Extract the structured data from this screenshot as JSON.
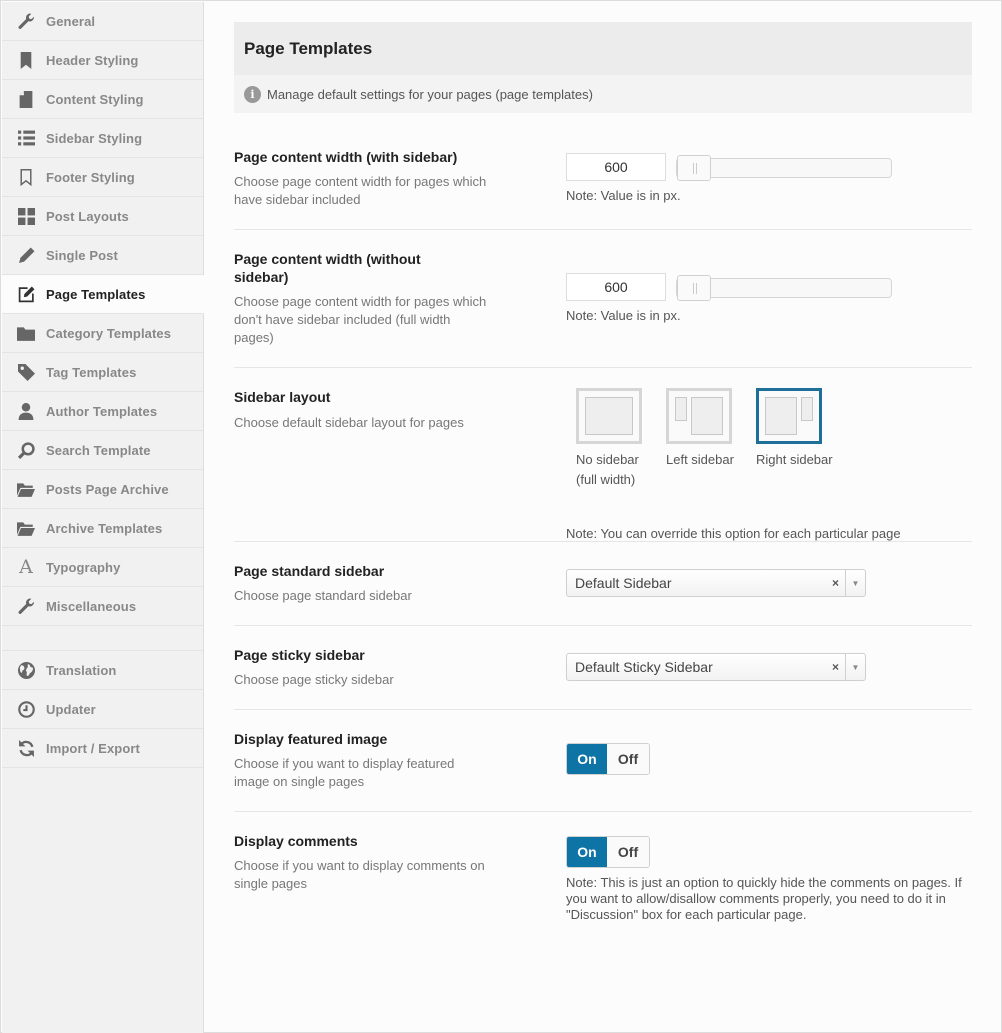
{
  "sidebar": {
    "items": [
      {
        "label": "General",
        "icon": "wrench-icon"
      },
      {
        "label": "Header Styling",
        "icon": "bookmark-icon"
      },
      {
        "label": "Content Styling",
        "icon": "document-icon"
      },
      {
        "label": "Sidebar Styling",
        "icon": "list-icon"
      },
      {
        "label": "Footer Styling",
        "icon": "bookmark-outline-icon"
      },
      {
        "label": "Post Layouts",
        "icon": "grid-icon"
      },
      {
        "label": "Single Post",
        "icon": "pencil-icon"
      },
      {
        "label": "Page Templates",
        "icon": "edit-icon"
      },
      {
        "label": "Category Templates",
        "icon": "folder-icon"
      },
      {
        "label": "Tag Templates",
        "icon": "tag-icon"
      },
      {
        "label": "Author Templates",
        "icon": "user-icon"
      },
      {
        "label": "Search Template",
        "icon": "search-icon"
      },
      {
        "label": "Posts Page Archive",
        "icon": "folder-open-icon"
      },
      {
        "label": "Archive Templates",
        "icon": "folder-open-icon"
      },
      {
        "label": "Typography",
        "icon": "font-icon"
      },
      {
        "label": "Miscellaneous",
        "icon": "wrench-icon"
      }
    ],
    "extra_items": [
      {
        "label": "Translation",
        "icon": "globe-icon"
      },
      {
        "label": "Updater",
        "icon": "clock-icon"
      },
      {
        "label": "Import / Export",
        "icon": "refresh-icon"
      }
    ],
    "active": "Page Templates"
  },
  "panel": {
    "title": "Page Templates",
    "info": "Manage default settings for your pages (page templates)"
  },
  "settings": {
    "width_sidebar": {
      "title": "Page content width (with sidebar)",
      "desc": "Choose page content width for pages which have sidebar included",
      "value": "600",
      "note": "Note: Value is in px."
    },
    "width_nosidebar": {
      "title": "Page content width (without sidebar)",
      "desc": "Choose page content width for pages which don't have sidebar included (full width pages)",
      "value": "600",
      "note": "Note: Value is in px."
    },
    "sidebar_layout": {
      "title": "Sidebar layout",
      "desc": "Choose default sidebar layout for pages",
      "options": [
        "No sidebar (full width)",
        "Left sidebar",
        "Right sidebar"
      ],
      "selected": "Right sidebar",
      "note": "Note: You can override this option for each particular page"
    },
    "standard_sidebar": {
      "title": "Page standard sidebar",
      "desc": "Choose page standard sidebar",
      "value": "Default Sidebar",
      "clear": "×"
    },
    "sticky_sidebar": {
      "title": "Page sticky sidebar",
      "desc": "Choose page sticky sidebar",
      "value": "Default Sticky Sidebar",
      "clear": "×"
    },
    "featured_image": {
      "title": "Display featured image",
      "desc": "Choose if you want to display featured image on single pages",
      "on": "On",
      "off": "Off",
      "state": "On"
    },
    "comments": {
      "title": "Display comments",
      "desc": "Choose if you want to display comments on single pages",
      "on": "On",
      "off": "Off",
      "state": "On",
      "note": "Note: This is just an option to quickly hide the comments on pages. If you want to allow/disallow comments properly, you need to do it in \"Discussion\" box for each particular page."
    }
  },
  "colors": {
    "accent": "#0e74a6",
    "selected_border": "#1e6f99"
  }
}
